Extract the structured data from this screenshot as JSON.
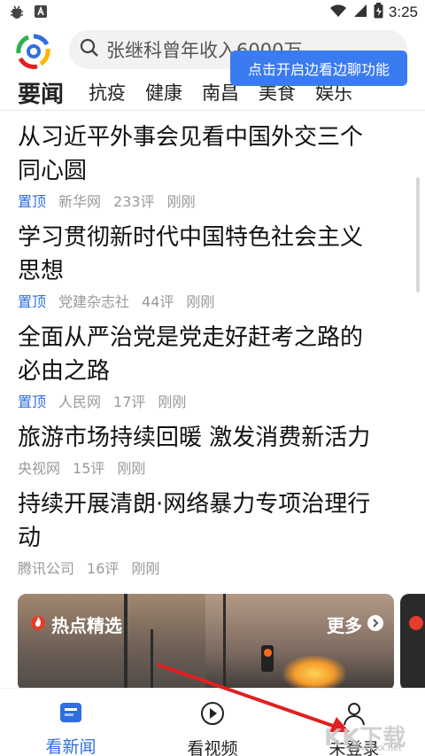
{
  "status_bar": {
    "left_icons": [
      "bug-icon",
      "a-notification-icon"
    ],
    "right_icons": [
      "wifi-icon",
      "signal-icon",
      "battery-icon"
    ],
    "time": "3:25"
  },
  "header": {
    "search_query": "张继科曾年收入6000万",
    "tooltip": "点击开启边看边聊功能"
  },
  "tabs": [
    {
      "label": "要闻",
      "active": true
    },
    {
      "label": "抗疫",
      "active": false
    },
    {
      "label": "健康",
      "active": false
    },
    {
      "label": "南昌",
      "active": false
    },
    {
      "label": "美食",
      "active": false
    },
    {
      "label": "娱乐",
      "active": false
    }
  ],
  "news": [
    {
      "title_l1": "从习近平外事会见看中国外交三个",
      "title_l2": "同心圆",
      "pinned": "置顶",
      "source": "新华网",
      "comments": "233评",
      "time": "刚刚"
    },
    {
      "title_l1": "学习贯彻新时代中国特色社会主义",
      "title_l2": "思想",
      "pinned": "置顶",
      "source": "党建杂志社",
      "comments": "44评",
      "time": "刚刚"
    },
    {
      "title_l1": "全面从严治党是党走好赶考之路的",
      "title_l2": "必由之路",
      "pinned": "置顶",
      "source": "人民网",
      "comments": "17评",
      "time": "刚刚"
    },
    {
      "title_l1": "旅游市场持续回暖 激发消费新活力",
      "title_l2": "",
      "pinned": "",
      "source": "央视网",
      "comments": "15评",
      "time": "刚刚"
    },
    {
      "title_l1": "持续开展清朗·网络暴力专项治理行",
      "title_l2": "动",
      "pinned": "",
      "source": "腾讯公司",
      "comments": "16评",
      "time": "刚刚"
    }
  ],
  "hot": {
    "label": "热点精选",
    "more": "更多"
  },
  "bottom_nav": [
    {
      "label": "看新闻",
      "icon": "news-icon",
      "active": true
    },
    {
      "label": "看视频",
      "icon": "play-icon",
      "active": false
    },
    {
      "label": "未登录",
      "icon": "user-icon",
      "active": false
    }
  ],
  "watermark": {
    "text": "KK下载",
    "url": "www.kkx.net"
  },
  "colors": {
    "accent": "#2f6fe0",
    "tooltip": "#3a7bf0",
    "arrow": "#e02020"
  }
}
